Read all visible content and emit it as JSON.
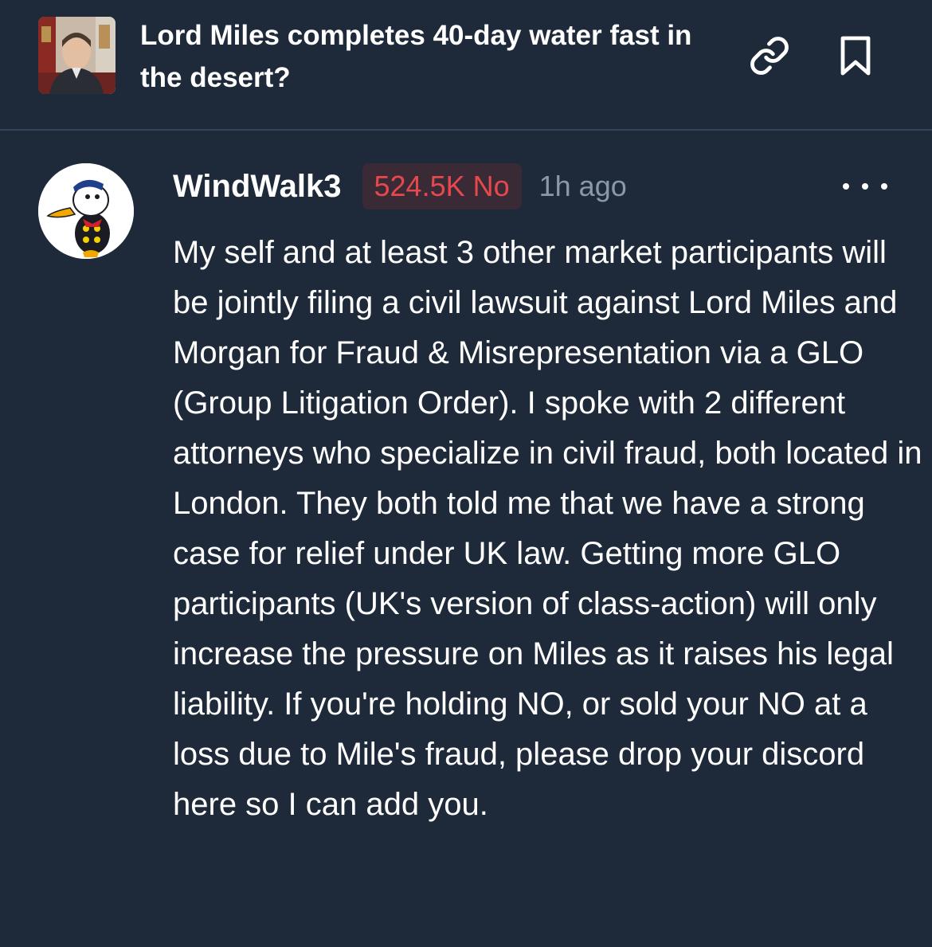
{
  "market": {
    "title": "Lord Miles completes 40-day water fast in the desert?",
    "thumbnail_icon": "market-photo",
    "link_icon": "link-icon",
    "bookmark_icon": "bookmark-icon"
  },
  "comment": {
    "username": "WindWalk3",
    "avatar_icon": "duck-avatar",
    "position": "524.5K No",
    "position_color": "#e5484d",
    "timestamp": "1h ago",
    "more_icon": "more-icon",
    "body": "My self and at least 3 other market participants will be jointly filing a civil lawsuit against Lord Miles and Morgan for Fraud & Misrepresentation via a GLO (Group Litigation Order). I spoke with 2 different attorneys who specialize in civil fraud, both located in London. They both told me that we have a strong case for relief under UK law. Getting more GLO participants (UK's version of class-action) will only increase the pressure on Miles as it raises his legal liability. If you're holding NO, or sold your NO at a loss due to Mile's fraud, please drop your discord here so I can add you."
  },
  "colors": {
    "background": "#1e2a3a",
    "divider": "#34445a",
    "muted_text": "#8b98aa",
    "no_red": "#e5484d"
  }
}
